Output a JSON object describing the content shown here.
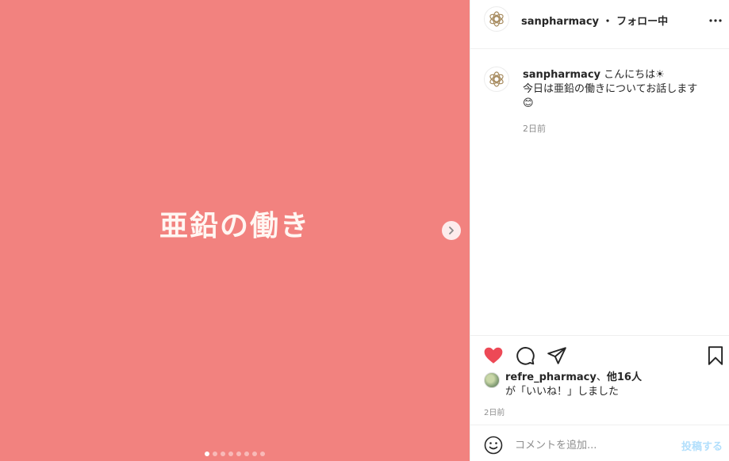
{
  "media": {
    "title": "亜鉛の働き",
    "background": "#f2827f",
    "slide_count": 8,
    "active_slide": 1
  },
  "header": {
    "username": "sanpharmacy",
    "separator": "・",
    "follow_status": "フォロー中"
  },
  "caption": {
    "username": "sanpharmacy",
    "line1": "こんにちは☀",
    "line2": "今日は亜鉛の働きについてお話します",
    "emoji": "😊",
    "time": "2日前"
  },
  "likes": {
    "user": "refre_pharmacy",
    "sep": "、",
    "others": "他16人",
    "suffix": "が「いいね！」しました"
  },
  "post_time": "2日前",
  "comment": {
    "placeholder": "コメントを追加...",
    "post_label": "投稿する"
  },
  "colors": {
    "like": "#ed4956",
    "post_button": "#b2dffc"
  }
}
